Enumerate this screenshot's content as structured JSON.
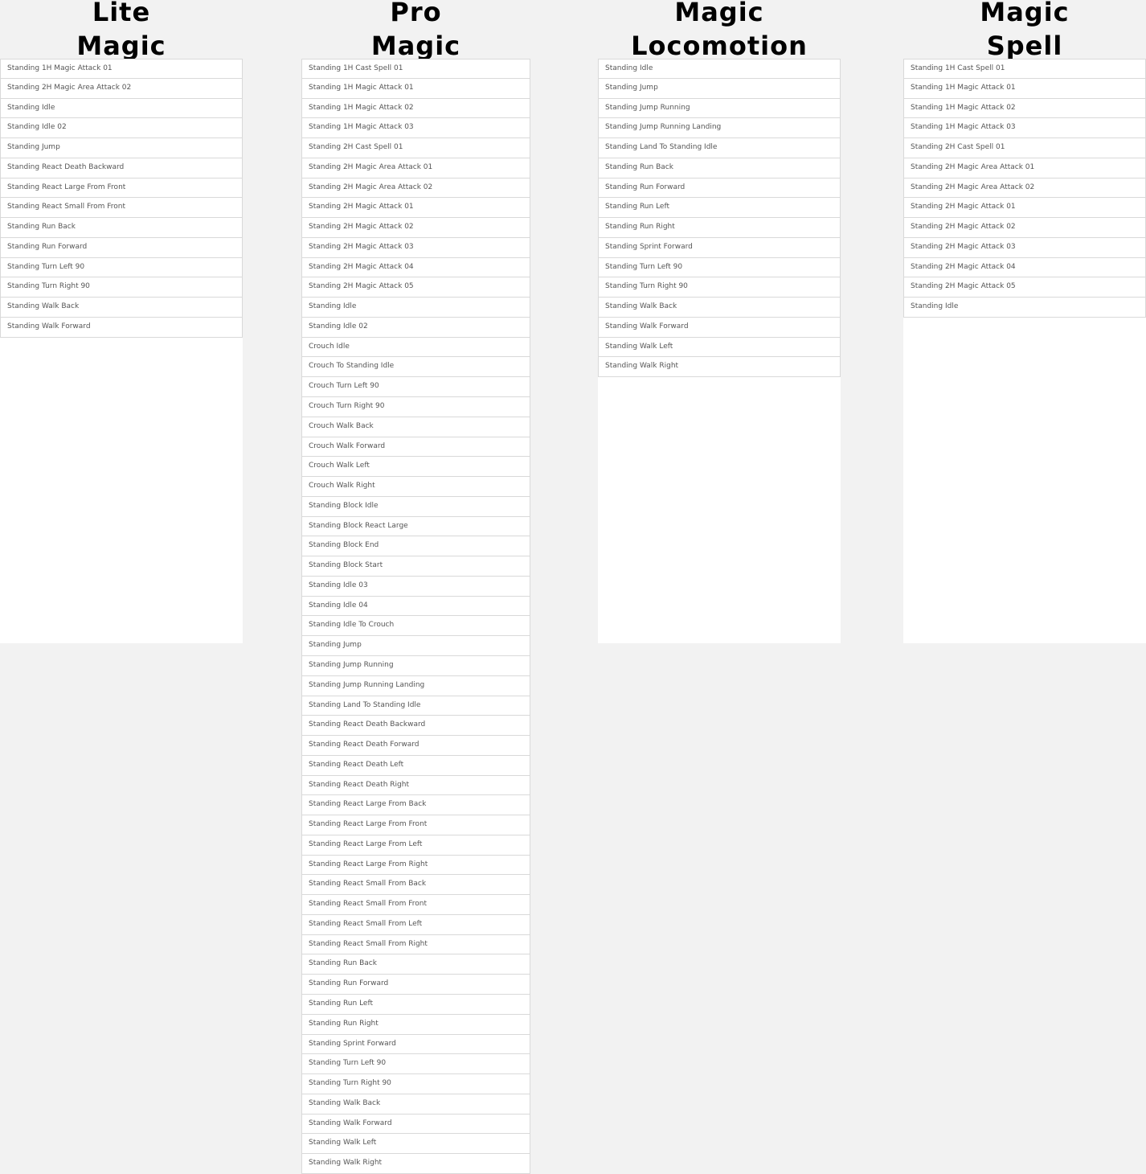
{
  "columns": {
    "lite": {
      "title_line1": "Lite",
      "title_line2": "Magic",
      "items": [
        "Standing 1H Magic Attack 01",
        "Standing 2H Magic Area Attack 02",
        "Standing Idle",
        "Standing Idle 02",
        "Standing Jump",
        "Standing React Death Backward",
        "Standing React Large From Front",
        "Standing React Small From Front",
        "Standing Run Back",
        "Standing Run Forward",
        "Standing Turn Left 90",
        "Standing Turn Right 90",
        "Standing Walk Back",
        "Standing Walk Forward"
      ]
    },
    "pro": {
      "title_line1": "Pro",
      "title_line2": "Magic",
      "items": [
        "Standing 1H Cast Spell 01",
        "Standing 1H Magic Attack 01",
        "Standing 1H Magic Attack 02",
        "Standing 1H Magic Attack 03",
        "Standing 2H Cast Spell 01",
        "Standing 2H Magic Area Attack 01",
        "Standing 2H Magic Area Attack 02",
        "Standing 2H Magic Attack 01",
        "Standing 2H Magic Attack 02",
        "Standing 2H Magic Attack 03",
        "Standing 2H Magic Attack 04",
        "Standing 2H Magic Attack 05",
        "Standing Idle",
        "Standing Idle 02",
        "Crouch Idle",
        "Crouch To Standing Idle",
        "Crouch Turn Left 90",
        "Crouch Turn Right 90",
        "Crouch Walk Back",
        "Crouch Walk Forward",
        "Crouch Walk Left",
        "Crouch Walk Right",
        "Standing Block Idle",
        "Standing Block React Large",
        "Standing Block End",
        "Standing Block Start",
        "Standing Idle 03",
        "Standing Idle 04",
        "Standing Idle To Crouch",
        "Standing Jump",
        "Standing Jump Running",
        "Standing Jump Running Landing",
        "Standing Land To Standing Idle",
        "Standing React Death Backward",
        "Standing React Death Forward",
        "Standing React Death Left",
        "Standing React Death Right",
        "Standing React Large From Back",
        "Standing React Large From Front",
        "Standing React Large From Left",
        "Standing React Large From Right",
        "Standing React Small From Back",
        "Standing React Small From Front",
        "Standing React Small From Left",
        "Standing React Small From Right",
        "Standing Run Back",
        "Standing Run Forward",
        "Standing Run Left",
        "Standing Run Right",
        "Standing Sprint Forward",
        "Standing Turn Left 90",
        "Standing Turn Right 90",
        "Standing Walk Back",
        "Standing Walk Forward",
        "Standing Walk Left",
        "Standing Walk Right"
      ]
    },
    "loco": {
      "title_line1": "Magic",
      "title_line2": "Locomotion",
      "items": [
        "Standing Idle",
        "Standing Jump",
        "Standing Jump Running",
        "Standing Jump Running Landing",
        "Standing Land To Standing Idle",
        "Standing Run Back",
        "Standing Run Forward",
        "Standing Run Left",
        "Standing Run Right",
        "Standing Sprint Forward",
        "Standing Turn Left 90",
        "Standing Turn Right 90",
        "Standing Walk Back",
        "Standing Walk Forward",
        "Standing Walk Left",
        "Standing Walk Right"
      ]
    },
    "spell": {
      "title_line1": "Magic",
      "title_line2": "Spell",
      "items": [
        "Standing 1H Cast Spell 01",
        "Standing 1H Magic Attack 01",
        "Standing 1H Magic Attack 02",
        "Standing 1H Magic Attack 03",
        "Standing 2H Cast Spell 01",
        "Standing 2H Magic Area Attack 01",
        "Standing 2H Magic Area Attack 02",
        "Standing 2H Magic Attack 01",
        "Standing 2H Magic Attack 02",
        "Standing 2H Magic Attack 03",
        "Standing 2H Magic Attack 04",
        "Standing 2H Magic Attack 05",
        "Standing Idle"
      ]
    }
  }
}
